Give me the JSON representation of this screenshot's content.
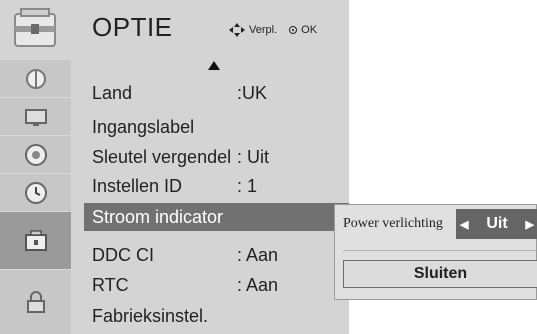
{
  "menu": {
    "title": "OPTIE",
    "hint_move": "Verpl.",
    "hint_ok": "OK",
    "rows": [
      {
        "label": "Land",
        "value": ":UK"
      },
      {
        "label": "Ingangslabel",
        "value": ""
      },
      {
        "label": "Sleutel vergendel",
        "value": ": Uit"
      },
      {
        "label": "Instellen ID",
        "value": ": 1"
      },
      {
        "label": "Stroom indicator",
        "value": ""
      },
      {
        "label": "DDC CI",
        "value": ": Aan"
      },
      {
        "label": "RTC",
        "value": ": Aan"
      },
      {
        "label": "Fabrieksinstel.",
        "value": ""
      }
    ]
  },
  "sidebar": {
    "icons": [
      "picture-icon",
      "monitor-icon",
      "speaker-icon",
      "clock-icon",
      "option-icon",
      "lock-icon"
    ]
  },
  "popup": {
    "label": "Power verlichting",
    "value": "Uit",
    "close_label": "Sluiten"
  },
  "colors": {
    "menu_bg": "#d4d4d4",
    "sidebar_bg": "#c7c7c7",
    "selected_row": "#717171",
    "selector_bg": "#656565"
  }
}
